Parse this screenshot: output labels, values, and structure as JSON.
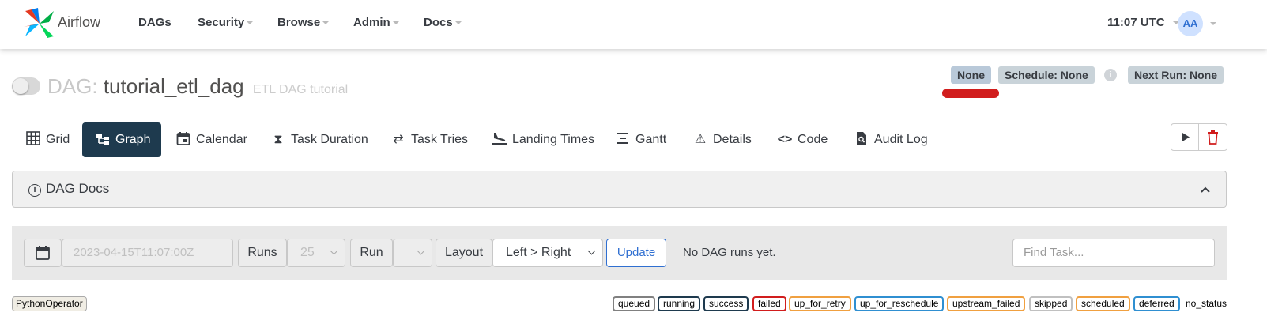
{
  "navbar": {
    "brand": "Airflow",
    "items": [
      {
        "label": "DAGs",
        "dropdown": false
      },
      {
        "label": "Security",
        "dropdown": true
      },
      {
        "label": "Browse",
        "dropdown": true
      },
      {
        "label": "Admin",
        "dropdown": true
      },
      {
        "label": "Docs",
        "dropdown": true
      }
    ],
    "clock": "11:07 UTC",
    "avatar_initials": "AA"
  },
  "dag": {
    "prefix": "DAG:",
    "name": "tutorial_etl_dag",
    "description": "ETL DAG tutorial",
    "paused": true,
    "badges": {
      "owner": "None",
      "schedule": "Schedule: None",
      "next_run": "Next Run: None"
    }
  },
  "tabs": [
    {
      "label": "Grid",
      "icon": "grid-icon",
      "active": false
    },
    {
      "label": "Graph",
      "icon": "graph-icon",
      "active": true
    },
    {
      "label": "Calendar",
      "icon": "calendar-icon",
      "active": false
    },
    {
      "label": "Task Duration",
      "icon": "hourglass-icon",
      "active": false
    },
    {
      "label": "Task Tries",
      "icon": "repeat-icon",
      "active": false
    },
    {
      "label": "Landing Times",
      "icon": "plane-landing-icon",
      "active": false
    },
    {
      "label": "Gantt",
      "icon": "gantt-icon",
      "active": false
    },
    {
      "label": "Details",
      "icon": "warning-triangle-icon",
      "active": false
    },
    {
      "label": "Code",
      "icon": "code-icon",
      "active": false
    },
    {
      "label": "Audit Log",
      "icon": "file-search-icon",
      "active": false
    }
  ],
  "docs_panel": {
    "title": "DAG Docs"
  },
  "filters": {
    "execution_date": "2023-04-15T11:07:00Z",
    "runs_label": "Runs",
    "runs_value": "25",
    "run_label": "Run",
    "run_value": "",
    "layout_label": "Layout",
    "layout_value": "Left > Right",
    "update_label": "Update",
    "status_text": "No DAG runs yet.",
    "find_placeholder": "Find Task..."
  },
  "legend": {
    "operator": {
      "label": "PythonOperator",
      "color": "#f0ede4"
    },
    "states": [
      {
        "label": "queued",
        "color": "#808080"
      },
      {
        "label": "running",
        "color": "#00ff00"
      },
      {
        "label": "success",
        "color": "#008000"
      },
      {
        "label": "failed",
        "color": "#ff0000"
      },
      {
        "label": "up_for_retry",
        "color": "#ffd700"
      },
      {
        "label": "up_for_reschedule",
        "color": "#40e0d0"
      },
      {
        "label": "upstream_failed",
        "color": "#ffa500"
      },
      {
        "label": "skipped",
        "color": "#ff69b4"
      },
      {
        "label": "scheduled",
        "color": "#d2b48c"
      },
      {
        "label": "deferred",
        "color": "#9370db"
      },
      {
        "label": "no_status",
        "color": "#ffffff"
      }
    ]
  }
}
